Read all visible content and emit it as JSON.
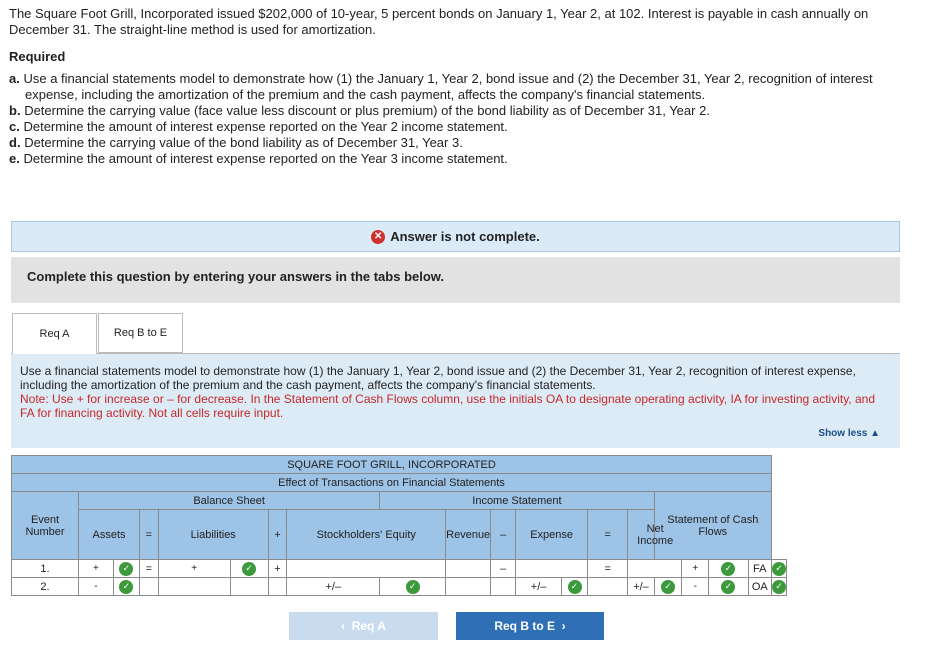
{
  "problem": {
    "intro": "The Square Foot Grill, Incorporated issued $202,000 of 10-year, 5 percent bonds on January 1, Year 2, at 102. Interest is payable in cash annually on December 31. The straight-line method is used for amortization.",
    "required_label": "Required",
    "items": [
      {
        "letter": "a.",
        "text": "Use a financial statements model to demonstrate how (1) the January 1, Year 2, bond issue and (2) the December 31, Year 2, recognition of interest expense, including the amortization of the premium and the cash payment, affects the company's financial statements."
      },
      {
        "letter": "b.",
        "text": "Determine the carrying value (face value less discount or plus premium) of the bond liability as of December 31, Year 2."
      },
      {
        "letter": "c.",
        "text": "Determine the amount of interest expense reported on the Year 2 income statement."
      },
      {
        "letter": "d.",
        "text": "Determine the carrying value of the bond liability as of December 31, Year 3."
      },
      {
        "letter": "e.",
        "text": "Determine the amount of interest expense reported on the Year 3 income statement."
      }
    ]
  },
  "banner": {
    "text": "Answer is not complete."
  },
  "complete_text": "Complete this question by entering your answers in the tabs below.",
  "tabs": [
    {
      "label": "Req A"
    },
    {
      "label": "Req B to E"
    }
  ],
  "panel": {
    "instruction": "Use a financial statements model to demonstrate how (1) the January 1, Year 2, bond issue and (2) the December 31, Year 2, recognition of interest expense, including the amortization of the premium and the cash payment, affects the company's financial statements.",
    "note": "Note: Use + for increase or – for decrease. In the Statement of Cash Flows column, use the initials OA to designate operating activity, IA for investing activity, and FA for financing activity. Not all cells require input.",
    "show_less": "Show less"
  },
  "table": {
    "company": "SQUARE FOOT GRILL, INCORPORATED",
    "subtitle": "Effect of Transactions on Financial Statements",
    "balance_sheet": "Balance Sheet",
    "income_statement": "Income Statement",
    "event_number": "Event Number",
    "assets": "Assets",
    "eq": "=",
    "liabilities": "Liabilities",
    "plus": "+",
    "stockholders_equity": "Stockholders' Equity",
    "revenue": "Revenue",
    "minus": "–",
    "expense": "Expense",
    "net_income": "Net Income",
    "cash_flows": "Statement of Cash Flows",
    "rows": [
      {
        "event": "1.",
        "assets_sign": "+",
        "eq": "=",
        "liab_sign": "+",
        "plus": "+",
        "se": "",
        "minus": "–",
        "expense": "",
        "eq2": "=",
        "ni": "",
        "cf_sign": "+",
        "cf_act": "FA"
      },
      {
        "event": "2.",
        "assets_sign": "-",
        "eq": "",
        "liab_sign": "",
        "plus": "",
        "se": "+/–",
        "minus": "",
        "expense": "+/–",
        "eq2": "",
        "ni": "+/–",
        "cf_sign": "-",
        "cf_act": "OA"
      }
    ]
  },
  "nav": {
    "prev": "Req A",
    "next": "Req B to E"
  },
  "colors": {
    "accent": "#2f6fb5",
    "header_blue": "#9dc3e6",
    "check_green": "#3c9a3c",
    "error_red": "#d0312d"
  }
}
